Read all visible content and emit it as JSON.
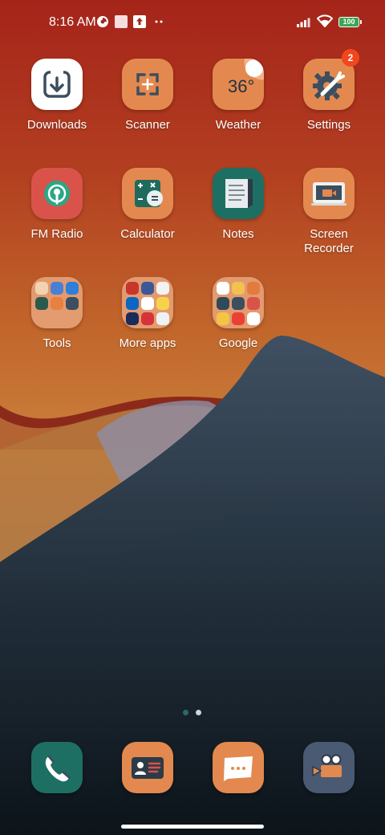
{
  "status_bar": {
    "time": "8:16 AM",
    "battery_level": "100",
    "notification_icons": [
      "data-saver-icon",
      "square-notification-icon",
      "upload-notification-icon",
      "more-notifications-icon"
    ]
  },
  "apps": {
    "downloads": {
      "label": "Downloads",
      "icon": "download-icon",
      "color": "#ffffff"
    },
    "scanner": {
      "label": "Scanner",
      "icon": "scan-icon",
      "color": "#e3894f"
    },
    "weather": {
      "label": "Weather",
      "icon": "weather-icon",
      "temperature": "36°",
      "color": "#e3894f"
    },
    "settings": {
      "label": "Settings",
      "icon": "gear-icon",
      "badge": "2",
      "color": "#e3894f"
    },
    "fm_radio": {
      "label": "FM Radio",
      "icon": "radio-icon",
      "color": "#d9534b"
    },
    "calculator": {
      "label": "Calculator",
      "icon": "calculator-icon",
      "color": "#e3894f"
    },
    "notes": {
      "label": "Notes",
      "icon": "notes-icon",
      "color": "#1e6f63"
    },
    "screen_recorder": {
      "label": "Screen\nRecorder",
      "icon": "screen-recorder-icon",
      "color": "#e3894f"
    }
  },
  "folders": {
    "tools": {
      "label": "Tools"
    },
    "more_apps": {
      "label": "More apps"
    },
    "google": {
      "label": "Google"
    }
  },
  "page_indicator": {
    "pages": 2,
    "current": 1
  },
  "dock": [
    {
      "name": "phone",
      "icon": "phone-icon",
      "color": "#1e6f63"
    },
    {
      "name": "contacts",
      "icon": "contacts-icon",
      "color": "#e3894f"
    },
    {
      "name": "messages",
      "icon": "messages-icon",
      "color": "#e3894f"
    },
    {
      "name": "camera",
      "icon": "camera-icon",
      "color": "#4a5a73"
    }
  ]
}
